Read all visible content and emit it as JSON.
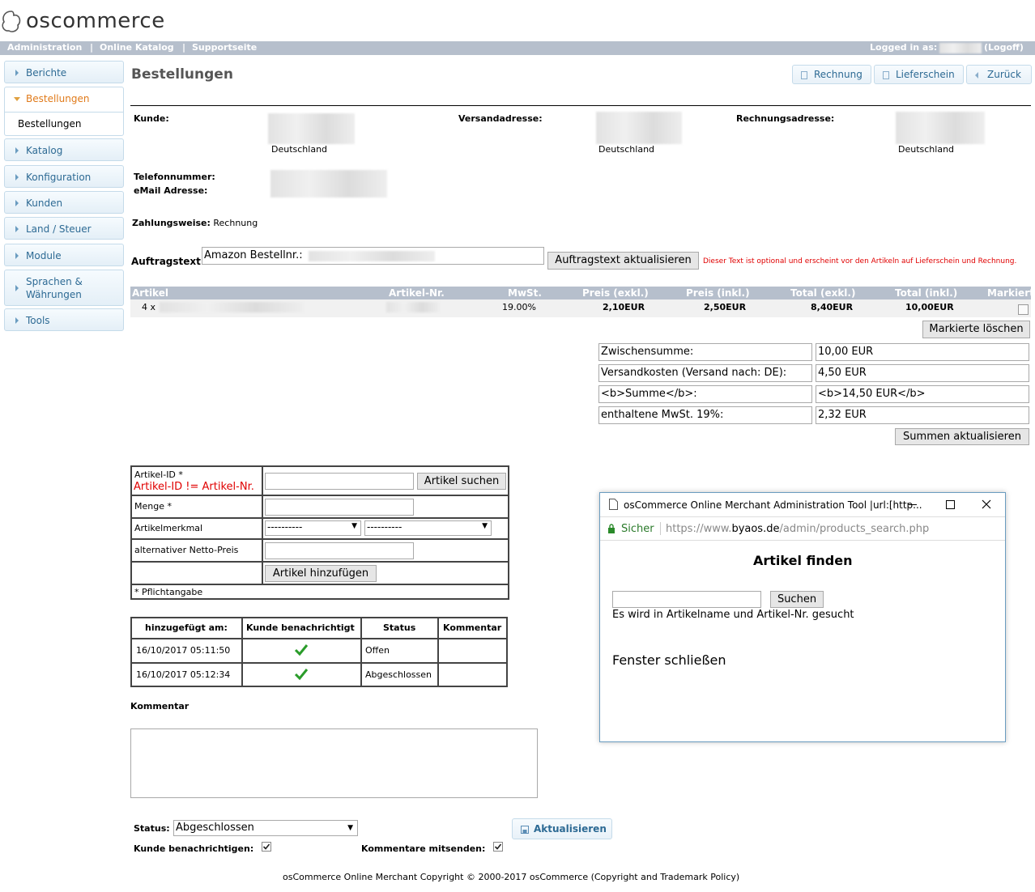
{
  "app": {
    "logo_text": "oscommerce"
  },
  "topbar": {
    "links": [
      "Administration",
      "|",
      "Online Katalog",
      "|",
      "Supportseite"
    ],
    "logged_in": "Logged in as:",
    "logoff": "(Logoff)"
  },
  "sidebar": {
    "items": [
      {
        "label": "Berichte"
      },
      {
        "label": "Bestellungen",
        "sub": "Bestellungen"
      },
      {
        "label": "Katalog"
      },
      {
        "label": "Konfiguration"
      },
      {
        "label": "Kunden"
      },
      {
        "label": "Land / Steuer"
      },
      {
        "label": "Module"
      },
      {
        "label": "Sprachen &",
        "label2": "Währungen"
      },
      {
        "label": "Tools"
      }
    ]
  },
  "page": {
    "title": "Bestellungen",
    "buttons": [
      "Rechnung",
      "Lieferschein",
      "Zurück"
    ]
  },
  "customer": {
    "kunde_label": "Kunde:",
    "versand_label": "Versandadresse:",
    "rechnung_label": "Rechnungsadresse:",
    "country": "Deutschland",
    "country2": "Deutschland",
    "country3": "Deutschland",
    "tel_label": "Telefonnummer:",
    "email_label": "eMail Adresse:",
    "payment_label": "Zahlungsweise:",
    "payment_value": "Rechnung"
  },
  "auftrag": {
    "label": "Auftragstext:",
    "value": "Amazon Bestellnr.:",
    "button": "Auftragstext aktualisieren",
    "hint": "Dieser Text ist optional und erscheint vor den Artikeln auf Lieferschein und Rechnung."
  },
  "articles": {
    "headers": [
      "Artikel",
      "Artikel-Nr.",
      "MwSt.",
      "Preis (exkl.)",
      "Preis (inkl.)",
      "Total (exkl.)",
      "Total (inkl.)",
      "Markiert"
    ],
    "row": {
      "qty": "4 x",
      "tax": "19.00%",
      "price_ex": "2,10EUR",
      "price_in": "2,50EUR",
      "total_ex": "8,40EUR",
      "total_in": "10,00EUR"
    },
    "delete_button": "Markierte löschen"
  },
  "totals": {
    "rows": [
      {
        "label": "Zwischensumme:",
        "value": "10,00 EUR"
      },
      {
        "label": "Versandkosten (Versand nach: DE):",
        "value": "4,50 EUR"
      },
      {
        "label": "<b>Summe</b>:",
        "value": "<b>14,50 EUR</b>"
      },
      {
        "label": "enthaltene MwSt. 19%:",
        "value": "2,32 EUR"
      }
    ],
    "update_button": "Summen aktualisieren"
  },
  "add_article": {
    "id_label": "Artikel-ID *",
    "id_warning": "Artikel-ID != Artikel-Nr.",
    "search_button": "Artikel suchen",
    "qty_label": "Menge *",
    "attr_label": "Artikelmerkmal",
    "attr_opt1": "----------",
    "attr_opt2": "----------",
    "price_label": "alternativer Netto-Preis",
    "add_button": "Artikel hinzufügen",
    "required_note": "* Pflichtangabe"
  },
  "history": {
    "headers": [
      "hinzugefügt am:",
      "Kunde benachrichtigt",
      "Status",
      "Kommentar"
    ],
    "rows": [
      {
        "date": "16/10/2017 05:11:50",
        "status": "Offen"
      },
      {
        "date": "16/10/2017 05:12:34",
        "status": "Abgeschlossen"
      }
    ]
  },
  "comment": {
    "label": "Kommentar"
  },
  "status_form": {
    "status_label": "Status:",
    "status_value": "Abgeschlossen",
    "update_button": "Aktualisieren",
    "notify_label": "Kunde benachrichtigen:",
    "send_comments_label": "Kommentare mitsenden:"
  },
  "footer": {
    "text": "osCommerce Online Merchant Copyright © 2000-2017 osCommerce (Copyright and Trademark Policy)"
  },
  "popup": {
    "title": "osCommerce Online Merchant Administration Tool |url:[http...",
    "secure": "Sicher",
    "url_prefix": "https://www.",
    "url_domain": "byaos.de",
    "url_path": "/admin/products_search.php",
    "heading": "Artikel finden",
    "search_button": "Suchen",
    "hint": "Es wird in Artikelname und Artikel-Nr. gesucht",
    "close_link": "Fenster schließen"
  },
  "colors": {
    "accent": "#2d6a94",
    "active": "#e07a1a",
    "bar": "#b6bfcc",
    "warning": "#e00000",
    "check": "#2a9c2a"
  }
}
